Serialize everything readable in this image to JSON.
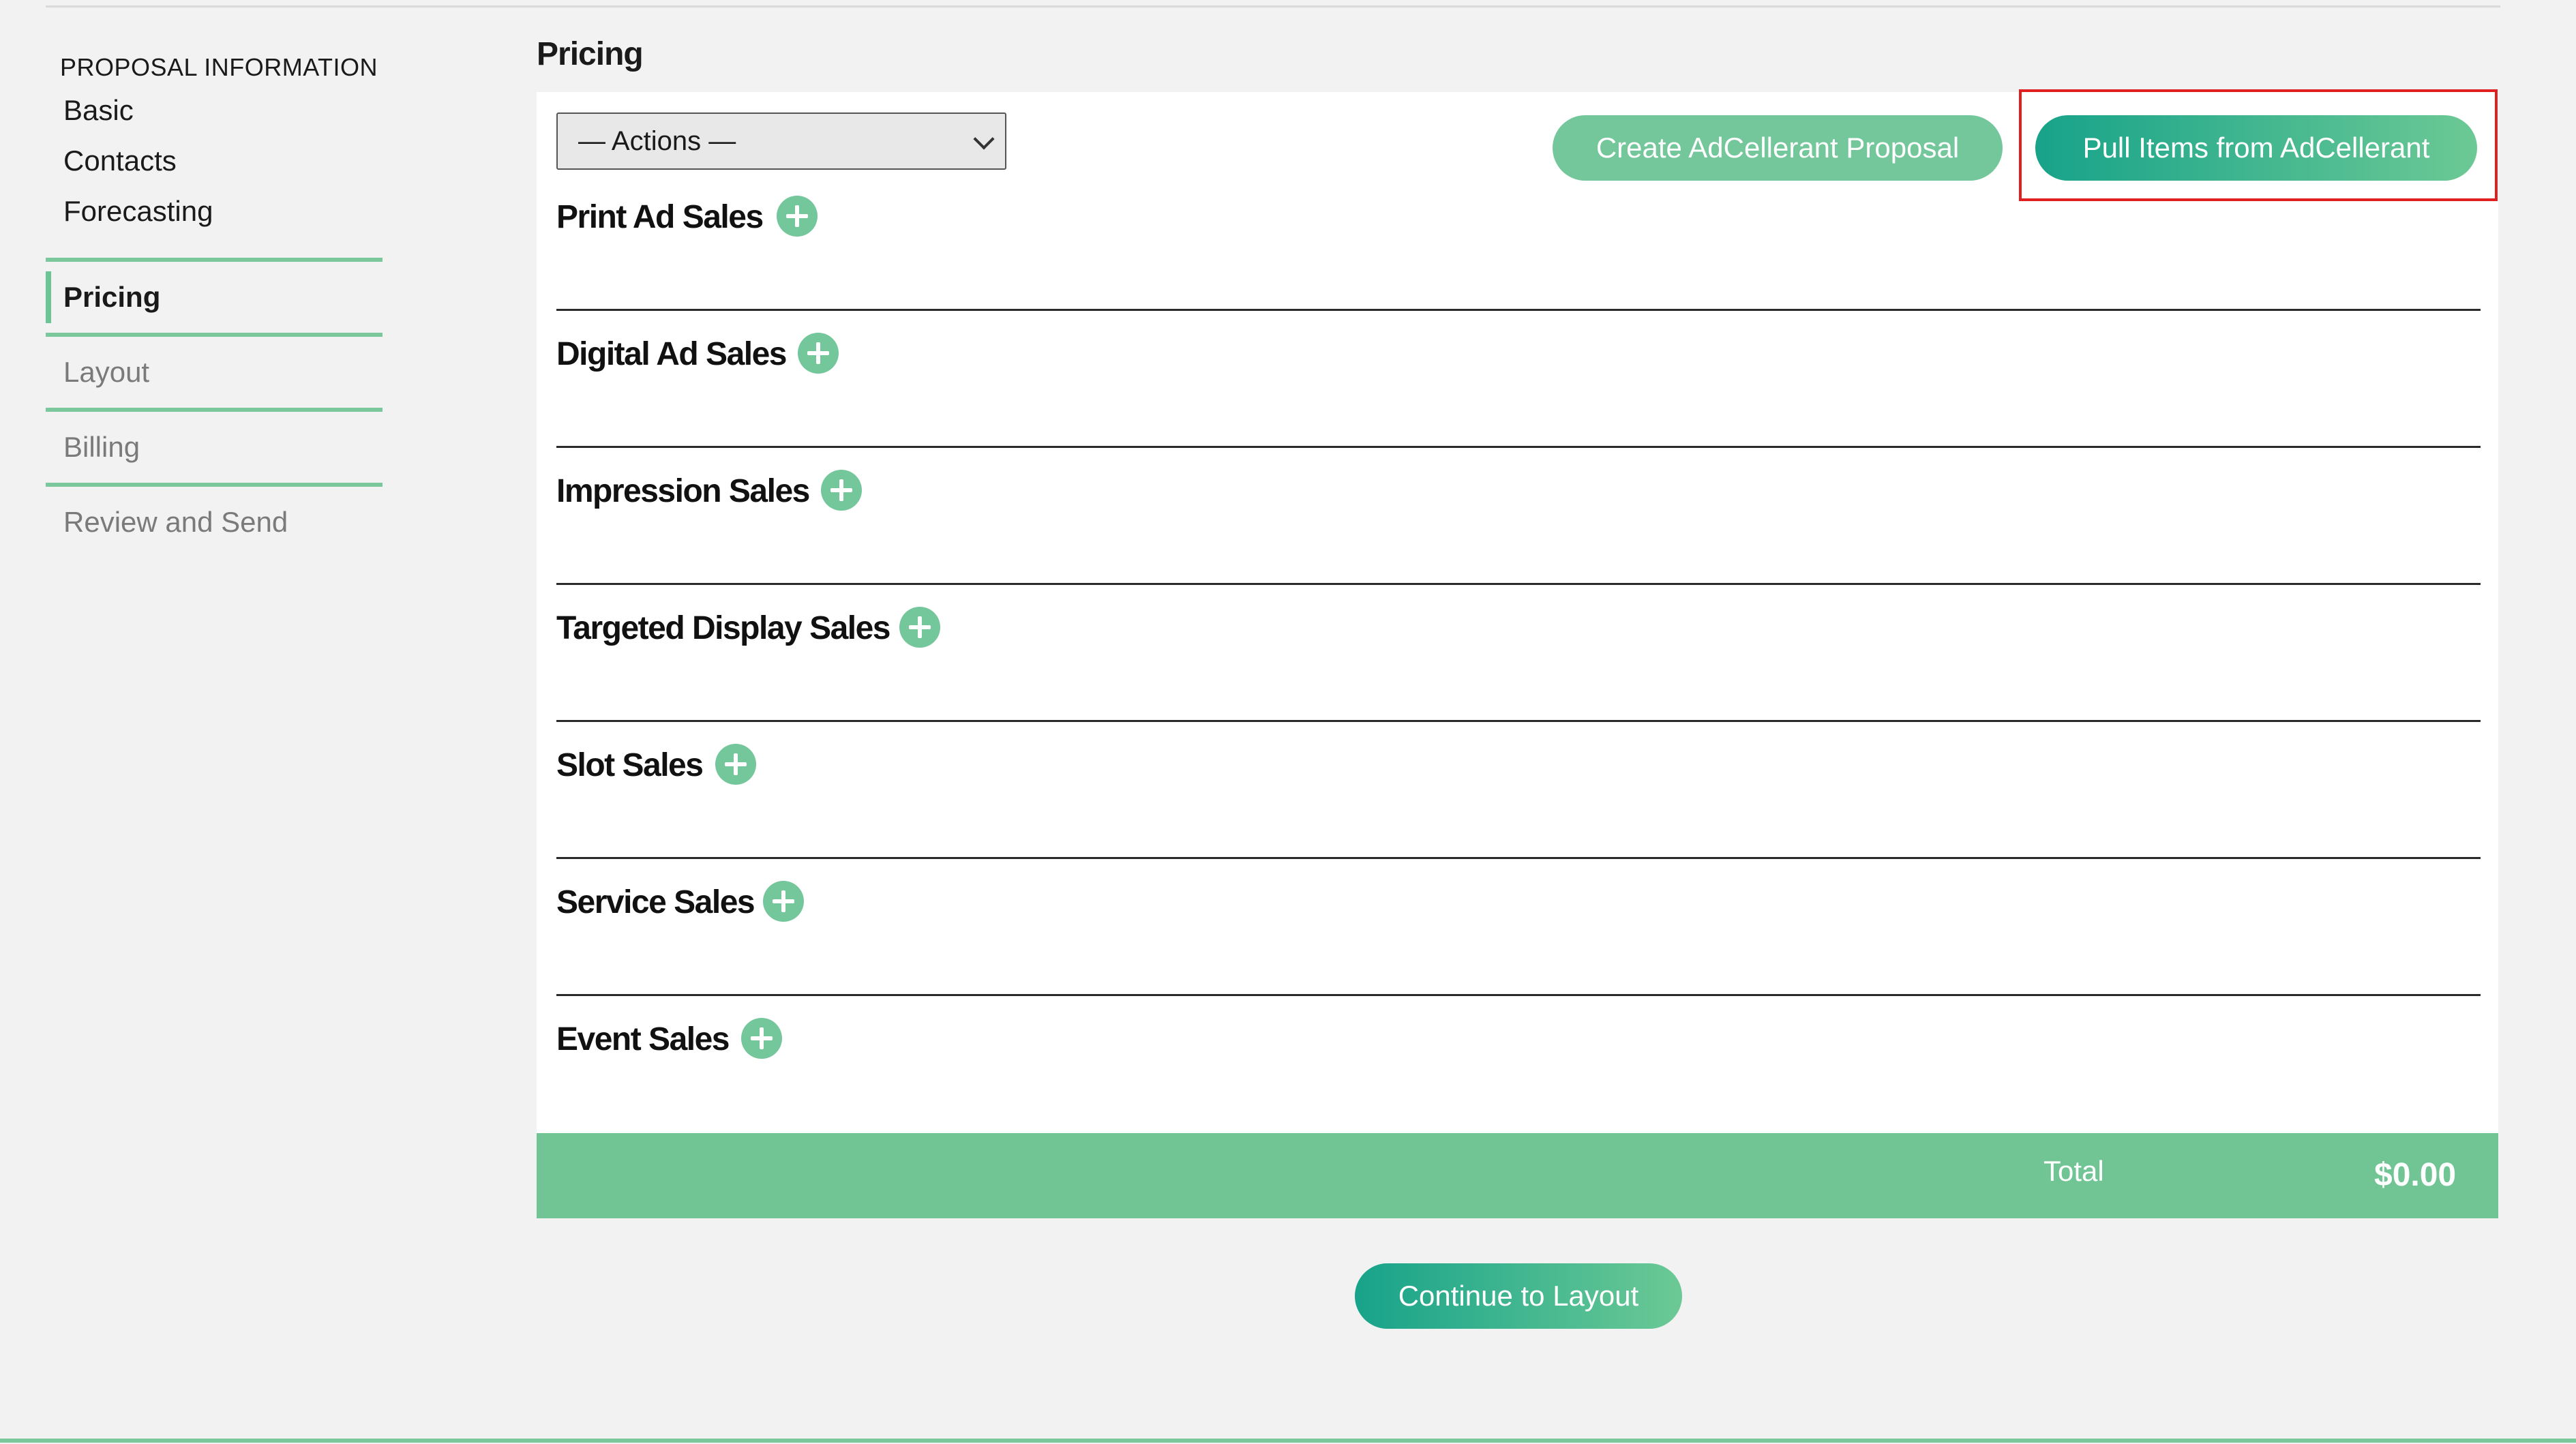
{
  "sidebar": {
    "heading": "PROPOSAL INFORMATION",
    "sub_items": [
      "Basic",
      "Contacts",
      "Forecasting"
    ],
    "steps": [
      {
        "label": "Pricing",
        "active": true
      },
      {
        "label": "Layout",
        "active": false
      },
      {
        "label": "Billing",
        "active": false
      },
      {
        "label": "Review and Send",
        "active": false
      }
    ]
  },
  "main": {
    "title": "Pricing",
    "actions_select": {
      "selected": "— Actions —"
    },
    "buttons": {
      "create": "Create AdCellerant Proposal",
      "pull": "Pull Items from AdCellerant"
    },
    "sections": [
      "Print Ad Sales",
      "Digital Ad Sales",
      "Impression Sales",
      "Targeted Display Sales",
      "Slot Sales",
      "Service Sales",
      "Event Sales"
    ],
    "total": {
      "label": "Total",
      "value": "$0.00"
    },
    "continue_label": "Continue to Layout"
  },
  "colors": {
    "accent_green": "#74c79b",
    "accent_teal": "#17a38a",
    "highlight_red": "#e02020",
    "background": "#f2f2f2"
  },
  "icons": {
    "add": "plus-circle-icon",
    "dropdown": "chevron-down-icon"
  }
}
